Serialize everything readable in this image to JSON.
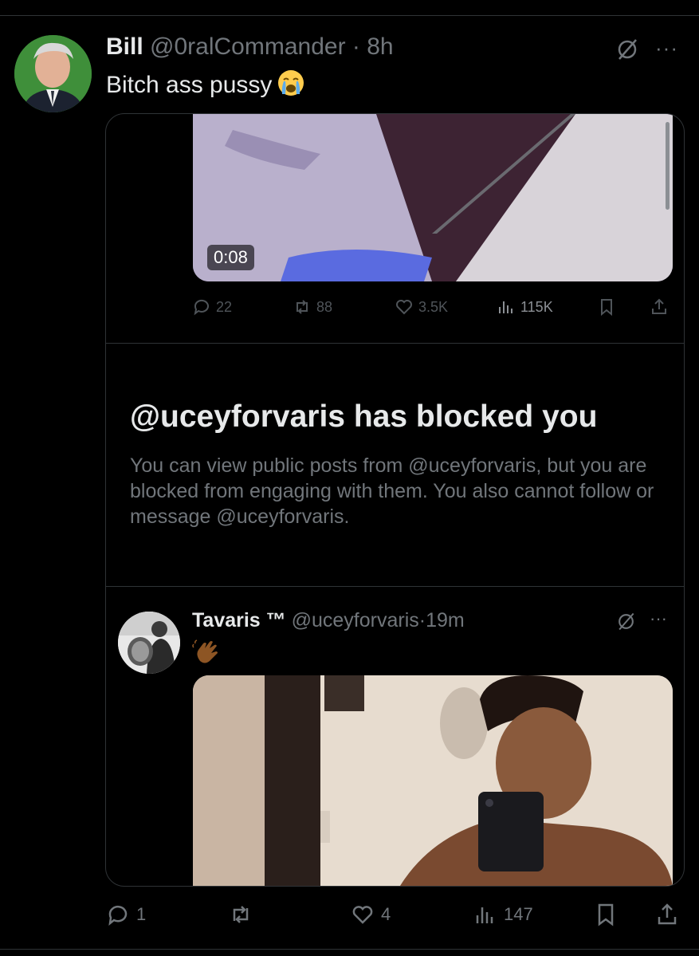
{
  "tweet": {
    "name": "Bill",
    "handle": "@0ralCommander",
    "separator": "·",
    "time": "8h",
    "text": "Bitch ass pussy",
    "emoji_icon": "loudly-crying-face-icon",
    "more_label": "···"
  },
  "quoted_video": {
    "duration": "0:08",
    "actions": {
      "replies": "22",
      "reposts": "88",
      "likes": "3.5K",
      "views": "115K"
    }
  },
  "blocked_notice": {
    "title": "@uceyforvaris has blocked you",
    "body": "You can view public posts from @uceyforvaris, but you are blocked from engaging with them. You also cannot follow or message @uceyforvaris."
  },
  "quoted_tweet": {
    "name": "Tavaris ™",
    "handle": "@uceyforvaris",
    "separator": "·",
    "time": "19m",
    "emoji_icon": "waving-hand-icon",
    "more_label": "···"
  },
  "actions": {
    "replies": "1",
    "reposts": "",
    "likes": "4",
    "views": "147"
  },
  "colors": {
    "background": "#000000",
    "text": "#e7e9ea",
    "muted": "#71767b",
    "border": "#2f3336"
  }
}
